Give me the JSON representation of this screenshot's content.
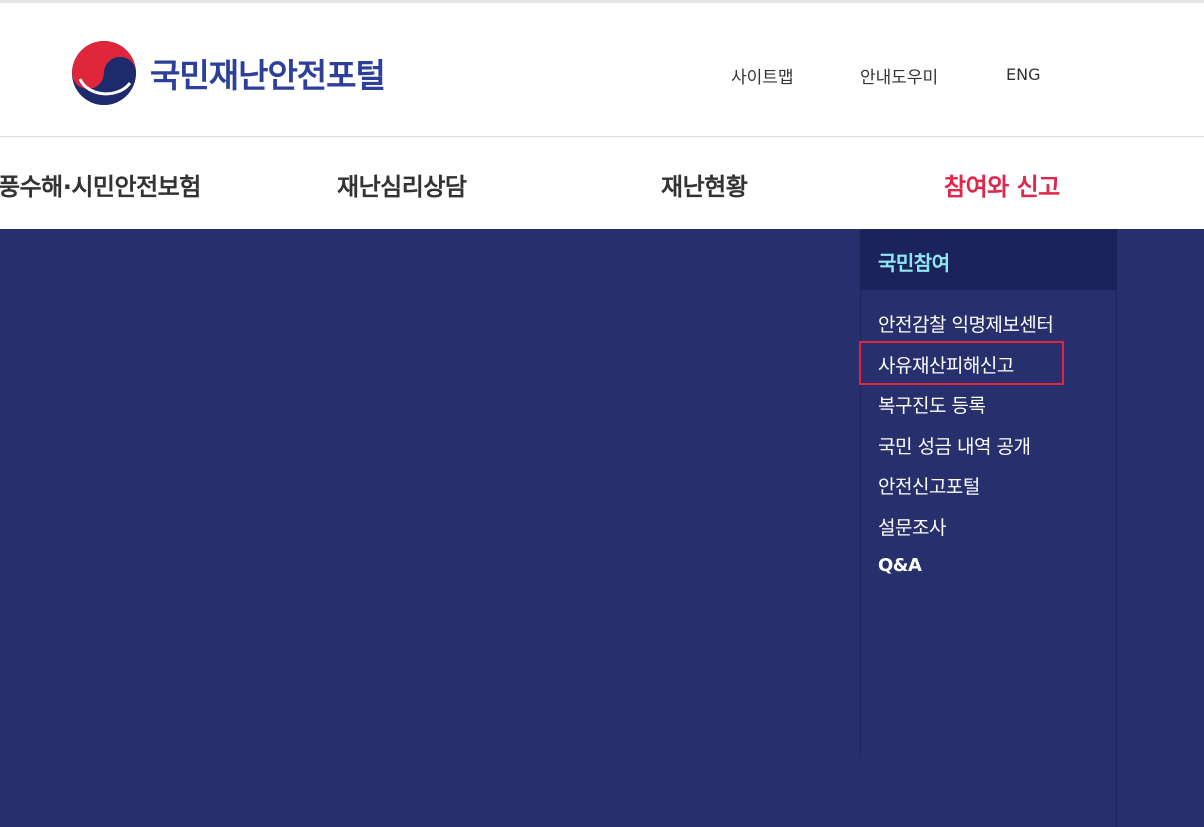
{
  "header": {
    "logo_text": "국민재난안전포털",
    "util_links": {
      "sitemap": "사이트맵",
      "guide": "안내도우미",
      "eng": "ENG"
    }
  },
  "gnb": {
    "items": [
      {
        "label": "풍수해·시민안전보험"
      },
      {
        "label": "재난심리상담"
      },
      {
        "label": "재난현황"
      },
      {
        "label": "참여와 신고",
        "active": true
      }
    ],
    "active_color": "#e0264b"
  },
  "dropdown": {
    "background": "#27306c",
    "section_title": "국민참여",
    "items": [
      {
        "label": "안전감찰 익명제보센터"
      },
      {
        "label": "사유재산피해신고",
        "highlighted": true
      },
      {
        "label": "복구진도 등록"
      },
      {
        "label": "국민 성금 내역 공개"
      },
      {
        "label": "안전신고포털"
      },
      {
        "label": "설문조사"
      },
      {
        "label": "Q&A"
      }
    ]
  },
  "icons": {
    "logo_emblem": "taegeuk-emblem-icon"
  }
}
